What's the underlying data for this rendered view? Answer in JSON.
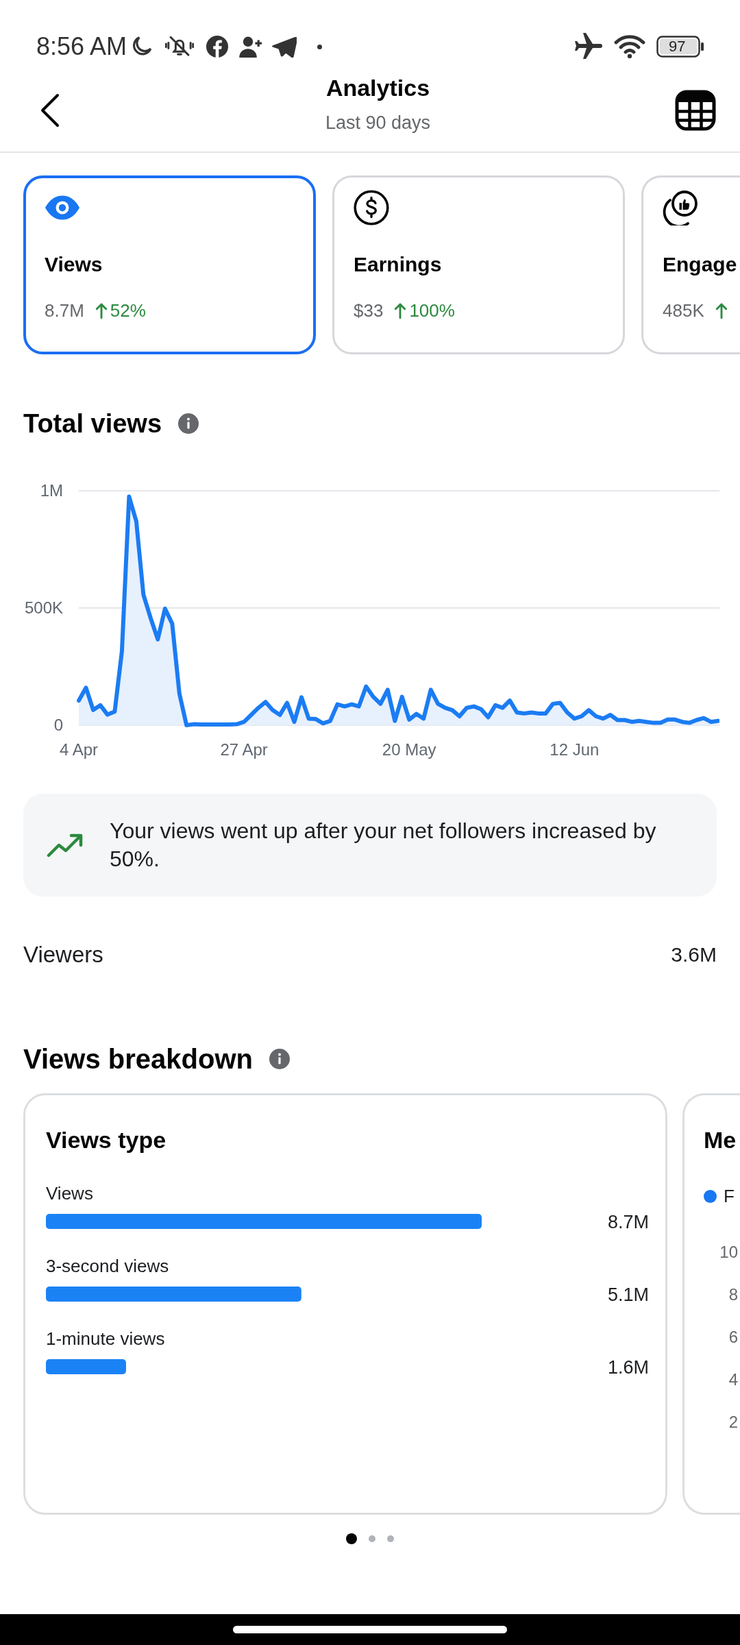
{
  "status_bar": {
    "time": "8:56 AM",
    "battery": "97"
  },
  "header": {
    "title": "Analytics",
    "subtitle": "Last 90 days"
  },
  "metric_cards": [
    {
      "label": "Views",
      "value": "8.7M",
      "rising": true,
      "change": "52%",
      "selected": true
    },
    {
      "label": "Earnings",
      "value": "$33",
      "rising": true,
      "change": "100%",
      "selected": false
    },
    {
      "label": "Engage",
      "value": "485K",
      "rising": true,
      "selected": false
    }
  ],
  "total_views": {
    "chart_data": {
      "type": "area",
      "title": "Total views",
      "categories": [
        "4 Apr",
        null,
        null,
        null,
        null,
        null,
        null,
        null,
        null,
        null,
        null,
        null,
        null,
        null,
        null,
        null,
        null,
        null,
        null,
        null,
        null,
        null,
        null,
        "27 Apr",
        null,
        null,
        null,
        null,
        null,
        null,
        null,
        null,
        null,
        null,
        null,
        null,
        null,
        null,
        null,
        null,
        null,
        null,
        null,
        null,
        null,
        null,
        "20 May",
        null,
        null,
        null,
        null,
        null,
        null,
        null,
        null,
        null,
        null,
        null,
        null,
        null,
        null,
        null,
        null,
        null,
        null,
        null,
        null,
        null,
        null,
        "12 Jun",
        null,
        null,
        null,
        null,
        null,
        null,
        null,
        null,
        null,
        null,
        null,
        null,
        null,
        null,
        null,
        null,
        null,
        null,
        null,
        null
      ],
      "values": [
        105000,
        160000,
        65000,
        85000,
        45000,
        58000,
        315000,
        975000,
        870000,
        557000,
        457000,
        366000,
        497000,
        433000,
        135000,
        0,
        4000,
        3000,
        3000,
        3000,
        3000,
        3000,
        4000,
        14000,
        44000,
        74000,
        99000,
        64000,
        44000,
        95000,
        14000,
        119000,
        28000,
        26000,
        8000,
        18000,
        89000,
        80000,
        89000,
        80000,
        165000,
        121000,
        91000,
        151000,
        18000,
        121000,
        24000,
        48000,
        28000,
        151000,
        91000,
        74000,
        64000,
        38000,
        74000,
        80000,
        68000,
        34000,
        85000,
        74000,
        105000,
        54000,
        50000,
        54000,
        50000,
        50000,
        91000,
        95000,
        54000,
        28000,
        38000,
        64000,
        38000,
        28000,
        44000,
        22000,
        22000,
        14000,
        18000,
        14000,
        10000,
        10000,
        24000,
        24000,
        14000,
        10000,
        22000,
        30000,
        14000,
        18000
      ],
      "ylim": [
        0,
        1000000
      ],
      "yticks": [
        {
          "value": 0,
          "label": "0"
        },
        {
          "value": 500000,
          "label": "500K"
        },
        {
          "value": 1000000,
          "label": "1M"
        }
      ]
    }
  },
  "insight": {
    "text": "Your views went up after your net followers increased by 50%."
  },
  "viewers": {
    "label": "Viewers",
    "value": "3.6M"
  },
  "views_breakdown": {
    "title": "Views breakdown",
    "cards": [
      {
        "kind": "bars",
        "chart_data": {
          "type": "bar",
          "orientation": "horizontal",
          "title": "Views type",
          "categories": [
            "Views",
            "3-second views",
            "1-minute views"
          ],
          "values": [
            8700000,
            5100000,
            1600000
          ],
          "value_labels": [
            "8.7M",
            "5.1M",
            "1.6M"
          ]
        }
      },
      {
        "kind": "chart",
        "title": "Me",
        "legend": [
          {
            "label": "F",
            "color": "#1877f2"
          }
        ],
        "y_labels": [
          "10",
          "8",
          "6",
          "4",
          "2"
        ]
      }
    ]
  },
  "pager": [
    {
      "selected": true
    },
    {
      "selected": false
    },
    {
      "selected": false
    }
  ]
}
